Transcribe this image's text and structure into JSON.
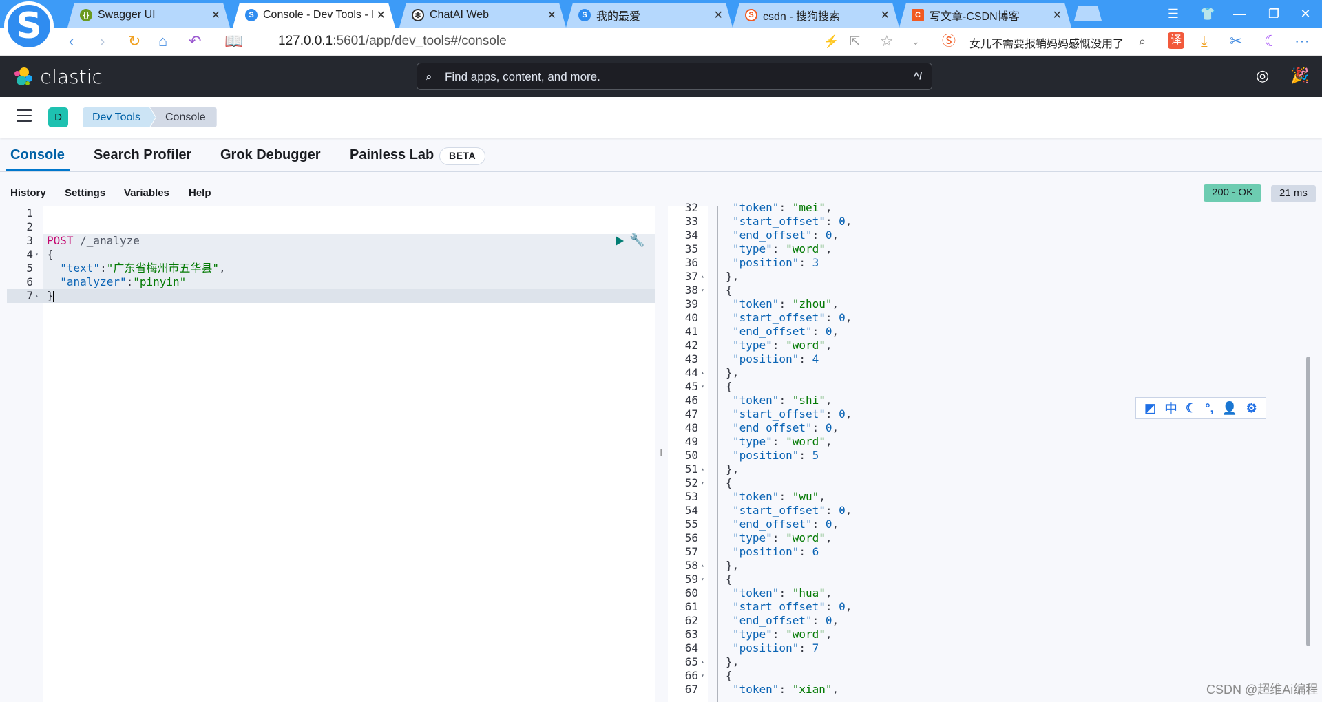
{
  "browser": {
    "tabs": [
      {
        "title": "Swagger UI",
        "icon": "swagger-icon",
        "active": false
      },
      {
        "title": "Console - Dev Tools - Elastic",
        "icon": "sogou-browser-icon",
        "active": true
      },
      {
        "title": "ChatAI Web",
        "icon": "openai-icon",
        "active": false
      },
      {
        "title": "我的最爱",
        "icon": "sogou-browser-icon",
        "active": false
      },
      {
        "title": "csdn - 搜狗搜索",
        "icon": "sogou-search-icon",
        "active": false
      },
      {
        "title": "写文章-CSDN博客",
        "icon": "csdn-icon",
        "active": false
      }
    ],
    "close_glyph": "✕",
    "url_host": "127.0.0.1",
    "url_rest": ":5601/app/dev_tools#/console",
    "news_ticker": "女儿不需要报销妈妈感慨没用了",
    "translate_label": "译"
  },
  "header": {
    "brand": "elastic",
    "search_placeholder": "Find apps, content, and more.",
    "search_shortcut": "^/"
  },
  "breadcrumb": {
    "space_initial": "D",
    "items": [
      "Dev Tools",
      "Console"
    ]
  },
  "devtools_tabs": [
    {
      "label": "Console",
      "active": true
    },
    {
      "label": "Search Profiler",
      "active": false
    },
    {
      "label": "Grok Debugger",
      "active": false
    },
    {
      "label": "Painless Lab",
      "active": false
    }
  ],
  "beta_badge": "BETA",
  "console_menu": [
    "History",
    "Settings",
    "Variables",
    "Help"
  ],
  "response_status": {
    "status": "200 - OK",
    "time": "21 ms",
    "status_color": "#6dccb1"
  },
  "request_editor": {
    "lines": [
      {
        "n": "1",
        "fold": "",
        "parts": []
      },
      {
        "n": "2",
        "fold": "",
        "parts": []
      },
      {
        "n": "3",
        "fold": "",
        "parts": [
          [
            "kw",
            "POST"
          ],
          [
            "path",
            " /_analyze"
          ]
        ]
      },
      {
        "n": "4",
        "fold": "▾",
        "parts": [
          [
            "punct",
            "{"
          ]
        ]
      },
      {
        "n": "5",
        "fold": "",
        "parts": [
          [
            "key",
            "  \"text\""
          ],
          [
            "punct",
            ":"
          ],
          [
            "str",
            "\"广东省梅州市五华县\""
          ],
          [
            "punct",
            ","
          ]
        ]
      },
      {
        "n": "6",
        "fold": "",
        "parts": [
          [
            "key",
            "  \"analyzer\""
          ],
          [
            "punct",
            ":"
          ],
          [
            "str",
            "\"pinyin\""
          ]
        ]
      },
      {
        "n": "7",
        "fold": "▴",
        "parts": [
          [
            "punct",
            "}"
          ]
        ]
      }
    ]
  },
  "response_editor": {
    "lines": [
      {
        "n": "32",
        "fold": "",
        "parts": [
          [
            "key",
            "\"token\""
          ],
          [
            "punct",
            ": "
          ],
          [
            "str",
            "\"mei\""
          ],
          [
            "punct",
            ","
          ]
        ],
        "indent": 2
      },
      {
        "n": "33",
        "fold": "",
        "parts": [
          [
            "key",
            "\"start_offset\""
          ],
          [
            "punct",
            ": "
          ],
          [
            "num-v",
            "0"
          ],
          [
            "punct",
            ","
          ]
        ],
        "indent": 2
      },
      {
        "n": "34",
        "fold": "",
        "parts": [
          [
            "key",
            "\"end_offset\""
          ],
          [
            "punct",
            ": "
          ],
          [
            "num-v",
            "0"
          ],
          [
            "punct",
            ","
          ]
        ],
        "indent": 2
      },
      {
        "n": "35",
        "fold": "",
        "parts": [
          [
            "key",
            "\"type\""
          ],
          [
            "punct",
            ": "
          ],
          [
            "str",
            "\"word\""
          ],
          [
            "punct",
            ","
          ]
        ],
        "indent": 2
      },
      {
        "n": "36",
        "fold": "",
        "parts": [
          [
            "key",
            "\"position\""
          ],
          [
            "punct",
            ": "
          ],
          [
            "num-v",
            "3"
          ]
        ],
        "indent": 2
      },
      {
        "n": "37",
        "fold": "▴",
        "parts": [
          [
            "punct",
            "},"
          ]
        ],
        "indent": 1
      },
      {
        "n": "38",
        "fold": "▾",
        "parts": [
          [
            "punct",
            "{"
          ]
        ],
        "indent": 1
      },
      {
        "n": "39",
        "fold": "",
        "parts": [
          [
            "key",
            "\"token\""
          ],
          [
            "punct",
            ": "
          ],
          [
            "str",
            "\"zhou\""
          ],
          [
            "punct",
            ","
          ]
        ],
        "indent": 2
      },
      {
        "n": "40",
        "fold": "",
        "parts": [
          [
            "key",
            "\"start_offset\""
          ],
          [
            "punct",
            ": "
          ],
          [
            "num-v",
            "0"
          ],
          [
            "punct",
            ","
          ]
        ],
        "indent": 2
      },
      {
        "n": "41",
        "fold": "",
        "parts": [
          [
            "key",
            "\"end_offset\""
          ],
          [
            "punct",
            ": "
          ],
          [
            "num-v",
            "0"
          ],
          [
            "punct",
            ","
          ]
        ],
        "indent": 2
      },
      {
        "n": "42",
        "fold": "",
        "parts": [
          [
            "key",
            "\"type\""
          ],
          [
            "punct",
            ": "
          ],
          [
            "str",
            "\"word\""
          ],
          [
            "punct",
            ","
          ]
        ],
        "indent": 2
      },
      {
        "n": "43",
        "fold": "",
        "parts": [
          [
            "key",
            "\"position\""
          ],
          [
            "punct",
            ": "
          ],
          [
            "num-v",
            "4"
          ]
        ],
        "indent": 2
      },
      {
        "n": "44",
        "fold": "▴",
        "parts": [
          [
            "punct",
            "},"
          ]
        ],
        "indent": 1
      },
      {
        "n": "45",
        "fold": "▾",
        "parts": [
          [
            "punct",
            "{"
          ]
        ],
        "indent": 1
      },
      {
        "n": "46",
        "fold": "",
        "parts": [
          [
            "key",
            "\"token\""
          ],
          [
            "punct",
            ": "
          ],
          [
            "str",
            "\"shi\""
          ],
          [
            "punct",
            ","
          ]
        ],
        "indent": 2
      },
      {
        "n": "47",
        "fold": "",
        "parts": [
          [
            "key",
            "\"start_offset\""
          ],
          [
            "punct",
            ": "
          ],
          [
            "num-v",
            "0"
          ],
          [
            "punct",
            ","
          ]
        ],
        "indent": 2
      },
      {
        "n": "48",
        "fold": "",
        "parts": [
          [
            "key",
            "\"end_offset\""
          ],
          [
            "punct",
            ": "
          ],
          [
            "num-v",
            "0"
          ],
          [
            "punct",
            ","
          ]
        ],
        "indent": 2
      },
      {
        "n": "49",
        "fold": "",
        "parts": [
          [
            "key",
            "\"type\""
          ],
          [
            "punct",
            ": "
          ],
          [
            "str",
            "\"word\""
          ],
          [
            "punct",
            ","
          ]
        ],
        "indent": 2
      },
      {
        "n": "50",
        "fold": "",
        "parts": [
          [
            "key",
            "\"position\""
          ],
          [
            "punct",
            ": "
          ],
          [
            "num-v",
            "5"
          ]
        ],
        "indent": 2
      },
      {
        "n": "51",
        "fold": "▴",
        "parts": [
          [
            "punct",
            "},"
          ]
        ],
        "indent": 1
      },
      {
        "n": "52",
        "fold": "▾",
        "parts": [
          [
            "punct",
            "{"
          ]
        ],
        "indent": 1
      },
      {
        "n": "53",
        "fold": "",
        "parts": [
          [
            "key",
            "\"token\""
          ],
          [
            "punct",
            ": "
          ],
          [
            "str",
            "\"wu\""
          ],
          [
            "punct",
            ","
          ]
        ],
        "indent": 2
      },
      {
        "n": "54",
        "fold": "",
        "parts": [
          [
            "key",
            "\"start_offset\""
          ],
          [
            "punct",
            ": "
          ],
          [
            "num-v",
            "0"
          ],
          [
            "punct",
            ","
          ]
        ],
        "indent": 2
      },
      {
        "n": "55",
        "fold": "",
        "parts": [
          [
            "key",
            "\"end_offset\""
          ],
          [
            "punct",
            ": "
          ],
          [
            "num-v",
            "0"
          ],
          [
            "punct",
            ","
          ]
        ],
        "indent": 2
      },
      {
        "n": "56",
        "fold": "",
        "parts": [
          [
            "key",
            "\"type\""
          ],
          [
            "punct",
            ": "
          ],
          [
            "str",
            "\"word\""
          ],
          [
            "punct",
            ","
          ]
        ],
        "indent": 2
      },
      {
        "n": "57",
        "fold": "",
        "parts": [
          [
            "key",
            "\"position\""
          ],
          [
            "punct",
            ": "
          ],
          [
            "num-v",
            "6"
          ]
        ],
        "indent": 2
      },
      {
        "n": "58",
        "fold": "▴",
        "parts": [
          [
            "punct",
            "},"
          ]
        ],
        "indent": 1
      },
      {
        "n": "59",
        "fold": "▾",
        "parts": [
          [
            "punct",
            "{"
          ]
        ],
        "indent": 1
      },
      {
        "n": "60",
        "fold": "",
        "parts": [
          [
            "key",
            "\"token\""
          ],
          [
            "punct",
            ": "
          ],
          [
            "str",
            "\"hua\""
          ],
          [
            "punct",
            ","
          ]
        ],
        "indent": 2
      },
      {
        "n": "61",
        "fold": "",
        "parts": [
          [
            "key",
            "\"start_offset\""
          ],
          [
            "punct",
            ": "
          ],
          [
            "num-v",
            "0"
          ],
          [
            "punct",
            ","
          ]
        ],
        "indent": 2
      },
      {
        "n": "62",
        "fold": "",
        "parts": [
          [
            "key",
            "\"end_offset\""
          ],
          [
            "punct",
            ": "
          ],
          [
            "num-v",
            "0"
          ],
          [
            "punct",
            ","
          ]
        ],
        "indent": 2
      },
      {
        "n": "63",
        "fold": "",
        "parts": [
          [
            "key",
            "\"type\""
          ],
          [
            "punct",
            ": "
          ],
          [
            "str",
            "\"word\""
          ],
          [
            "punct",
            ","
          ]
        ],
        "indent": 2
      },
      {
        "n": "64",
        "fold": "",
        "parts": [
          [
            "key",
            "\"position\""
          ],
          [
            "punct",
            ": "
          ],
          [
            "num-v",
            "7"
          ]
        ],
        "indent": 2
      },
      {
        "n": "65",
        "fold": "▴",
        "parts": [
          [
            "punct",
            "},"
          ]
        ],
        "indent": 1
      },
      {
        "n": "66",
        "fold": "▾",
        "parts": [
          [
            "punct",
            "{"
          ]
        ],
        "indent": 1
      },
      {
        "n": "67",
        "fold": "",
        "parts": [
          [
            "key",
            "\"token\""
          ],
          [
            "punct",
            ": "
          ],
          [
            "str",
            "\"xian\""
          ],
          [
            "punct",
            ","
          ]
        ],
        "indent": 2
      }
    ]
  },
  "ime_toolbar": {
    "chinese_mode": "中"
  },
  "watermark": "CSDN @超维Ai编程"
}
